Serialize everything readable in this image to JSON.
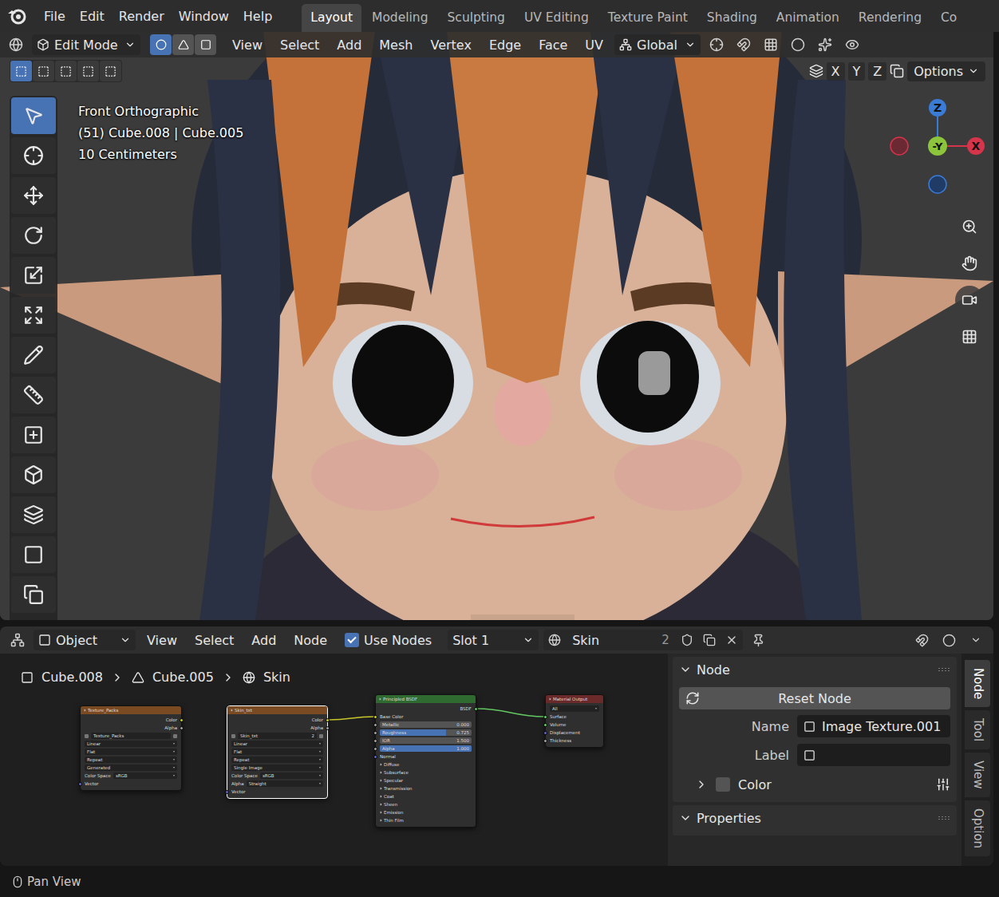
{
  "topbar": {
    "menus": [
      "File",
      "Edit",
      "Render",
      "Window",
      "Help"
    ],
    "workspaces": [
      {
        "label": "Layout",
        "selected": true
      },
      {
        "label": "Modeling",
        "selected": false
      },
      {
        "label": "Sculpting",
        "selected": false
      },
      {
        "label": "UV Editing",
        "selected": false
      },
      {
        "label": "Texture Paint",
        "selected": false
      },
      {
        "label": "Shading",
        "selected": false
      },
      {
        "label": "Animation",
        "selected": false
      },
      {
        "label": "Rendering",
        "selected": false
      },
      {
        "label": "Co",
        "selected": false
      }
    ]
  },
  "viewport": {
    "mode": "Edit Mode",
    "select_modes": [
      {
        "selected": true
      },
      {
        "selected": false
      },
      {
        "selected": false
      }
    ],
    "menus": [
      "View",
      "Select",
      "Add",
      "Mesh",
      "Vertex",
      "Edge",
      "Face",
      "UV"
    ],
    "orientation": "Global",
    "box_modes": [
      {
        "selected": true
      },
      {
        "selected": false
      },
      {
        "selected": false
      },
      {
        "selected": false
      },
      {
        "selected": false
      }
    ],
    "mirror_axes": [
      "X",
      "Y",
      "Z"
    ],
    "options": "Options",
    "info": [
      "Front Orthographic",
      "(51) Cube.008 | Cube.005",
      "10 Centimeters"
    ],
    "gizmo": {
      "z": "Z",
      "y": "-Y",
      "x": "X"
    },
    "tools": [
      {
        "selected": true
      },
      {
        "selected": false
      },
      {
        "selected": false
      },
      {
        "selected": false
      },
      {
        "selected": false
      },
      {
        "selected": false
      },
      {
        "selected": false
      },
      {
        "selected": false
      },
      {
        "selected": false
      },
      {
        "selected": false
      },
      {
        "selected": false
      },
      {
        "selected": false
      },
      {
        "selected": false
      }
    ]
  },
  "node_editor": {
    "type": "Object",
    "menus": [
      "View",
      "Select",
      "Add",
      "Node"
    ],
    "use_nodes": {
      "label": "Use Nodes",
      "checked": true
    },
    "slot": "Slot 1",
    "material": "Skin",
    "users": "2",
    "breadcrumbs": [
      "Cube.008",
      "Cube.005",
      "Skin"
    ],
    "nodes": [
      {
        "title": "Texture_Packs",
        "selected": false,
        "color": "#7a4b22",
        "rows": [
          {
            "kind": "output",
            "label": "Color",
            "color": "#c7c729"
          },
          {
            "kind": "output",
            "label": "Alpha",
            "color": "#a1a1a1"
          },
          {
            "kind": "image",
            "label": "Texture_Packs"
          },
          {
            "kind": "field",
            "label": "Linear"
          },
          {
            "kind": "field",
            "label": "Flat"
          },
          {
            "kind": "field",
            "label": "Repeat"
          },
          {
            "kind": "field",
            "label": "Generated"
          },
          {
            "kind": "labeled_field",
            "label": "Color Space",
            "value": "sRGB"
          },
          {
            "kind": "input",
            "label": "Vector",
            "color": "#6363c7"
          }
        ]
      },
      {
        "title": "Skin_txt",
        "selected": true,
        "color": "#7a4b22",
        "rows": [
          {
            "kind": "output",
            "label": "Color",
            "color": "#c7c729"
          },
          {
            "kind": "output",
            "label": "Alpha",
            "color": "#a1a1a1"
          },
          {
            "kind": "image",
            "label": "Skin_txt",
            "users": "2"
          },
          {
            "kind": "field",
            "label": "Linear"
          },
          {
            "kind": "field",
            "label": "Flat"
          },
          {
            "kind": "field",
            "label": "Repeat"
          },
          {
            "kind": "field",
            "label": "Single Image"
          },
          {
            "kind": "labeled_field",
            "label": "Color Space",
            "value": "sRGB"
          },
          {
            "kind": "labeled_field",
            "label": "Alpha",
            "value": "Straight"
          },
          {
            "kind": "input",
            "label": "Vector",
            "color": "#6363c7"
          }
        ]
      },
      {
        "title": "Principled BSDF",
        "selected": false,
        "color": "#2f6a31",
        "rows": [
          {
            "kind": "output",
            "label": "BSDF",
            "color": "#63c763"
          },
          {
            "kind": "input",
            "label": "Base Color",
            "color": "#c7c729"
          },
          {
            "kind": "slider",
            "label": "Metallic",
            "value": "0.000",
            "level": 0,
            "color": "#a1a1a1"
          },
          {
            "kind": "slider",
            "label": "Roughness",
            "value": "0.725",
            "level": 0.725,
            "color": "#a1a1a1"
          },
          {
            "kind": "slider",
            "label": "IOR",
            "value": "1.500",
            "level": 0,
            "color": "#a1a1a1"
          },
          {
            "kind": "slider",
            "label": "Alpha",
            "value": "1.000",
            "level": 1,
            "color": "#a1a1a1"
          },
          {
            "kind": "input",
            "label": "Normal",
            "color": "#6363c7"
          },
          {
            "kind": "panel",
            "label": "Diffuse"
          },
          {
            "kind": "panel",
            "label": "Subsurface"
          },
          {
            "kind": "panel",
            "label": "Specular"
          },
          {
            "kind": "panel",
            "label": "Transmission"
          },
          {
            "kind": "panel",
            "label": "Coat"
          },
          {
            "kind": "panel",
            "label": "Sheen"
          },
          {
            "kind": "panel",
            "label": "Emission"
          },
          {
            "kind": "panel",
            "label": "Thin Film"
          }
        ]
      },
      {
        "title": "Material Output",
        "selected": false,
        "color": "#6b2a2a",
        "rows": [
          {
            "kind": "field",
            "label": "All"
          },
          {
            "kind": "input",
            "label": "Surface",
            "color": "#63c763"
          },
          {
            "kind": "input",
            "label": "Volume",
            "color": "#63c763"
          },
          {
            "kind": "input",
            "label": "Displacement",
            "color": "#6363c7"
          },
          {
            "kind": "input",
            "label": "Thickness",
            "color": "#a1a1a1"
          }
        ]
      }
    ],
    "sidebar": {
      "tabs": [
        {
          "label": "Node",
          "selected": true
        },
        {
          "label": "Tool",
          "selected": false
        },
        {
          "label": "View",
          "selected": false
        },
        {
          "label": "Option",
          "selected": false
        }
      ],
      "section": {
        "title": "Node",
        "expanded": true
      },
      "reset": "Reset Node",
      "fields": [
        {
          "label": "Name",
          "value": "Image Texture.001"
        },
        {
          "label": "Label",
          "value": ""
        }
      ],
      "color_panel": {
        "label": "Color",
        "expanded": false,
        "checked": false
      },
      "properties": {
        "title": "Properties",
        "expanded": true
      }
    }
  },
  "status_bar": {
    "hint": "Pan View"
  }
}
